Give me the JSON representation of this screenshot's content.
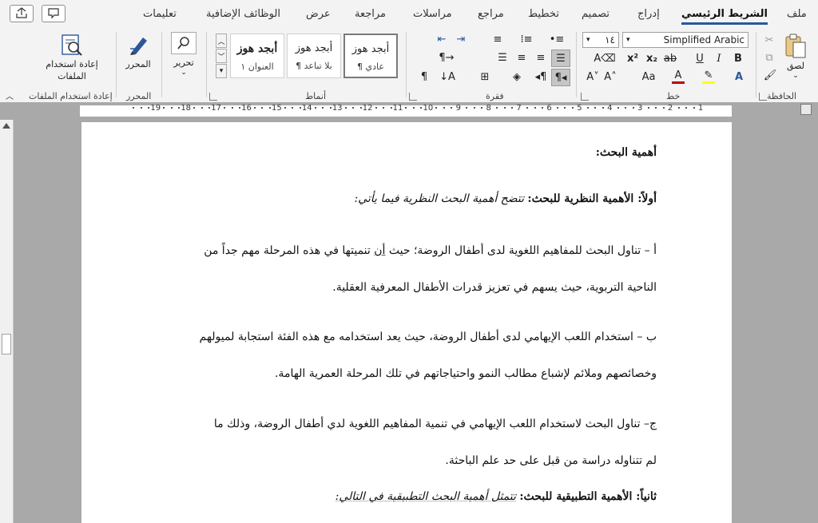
{
  "tabs": [
    "ملف",
    "الشريط الرئيسي",
    "إدراج",
    "تصميم",
    "تخطيط",
    "مراجع",
    "مراسلات",
    "مراجعة",
    "عرض",
    "الوظائف الإضافية",
    "تعليمات"
  ],
  "groups": {
    "clipboard": {
      "label": "الحافظة",
      "paste": "لصق"
    },
    "font": {
      "label": "خط",
      "font_name": "Simplified Arabic",
      "font_size": "١٤"
    },
    "paragraph": {
      "label": "فقرة"
    },
    "styles": {
      "label": "أنماط",
      "items": [
        {
          "preview": "أبجد هوز",
          "name": "¶ عادي"
        },
        {
          "preview": "أبجد هوز",
          "name": "¶ بلا تباعد"
        },
        {
          "preview": "أبجد هوز",
          "name": "العنوان ١"
        }
      ]
    },
    "editing": {
      "edit": "تحرير",
      "editor": "المحرر",
      "editor_group": "المحرر"
    },
    "reuse": {
      "button_line1": "إعادة استخدام",
      "button_line2": "الملفات",
      "label": "إعادة استخدام الملفات"
    }
  },
  "ruler": [
    "1",
    "2",
    "3",
    "4",
    "5",
    "6",
    "7",
    "8",
    "9",
    "10",
    "11",
    "12",
    "13",
    "14",
    "15",
    "16",
    "17",
    "18",
    "19"
  ],
  "document": {
    "heading": "أهمية البحث:",
    "theory_bold": "أولاً: الأهمية النظرية للبحث:",
    "theory_italic": "تتضح أهمية البحث النظرية فيما يأتي:",
    "a_line1_pre": "أ – تناول البحث للمفاهيم اللغوية لدى أطفال الروضة؛ حيث",
    "a_line1_ul": "أن",
    "a_line1_post": "تنميتها في هذه المرحلة مهم جداً من",
    "a_line2": "الناحية التربوية، حيث يسهم في تعزيز قدرات الأطفال المعرفية العقلية.",
    "b_line1": "ب – استخدام اللعب الإيهامي لدى أطفال الروضة، حيث يعد استخدامه مع هذه الفئة استجابة لميولهم",
    "b_line2": "وخصائصهم وملائم لإشباع مطالب النمو واحتياجاتهم في تلك المرحلة العمرية الهامة.",
    "c_line1": "ج– تناول البحث لاستخدام اللعب الإيهامي في تنمية المفاهيم اللغوية لدي أطفال الروضة، وذلك ما",
    "c_line2": "لم تتناوله دراسة من قبل على حد علم الباحثة.",
    "applied_bold": "ثانياً: الأهمية التطبيقية للبحث:",
    "applied_italic": "تتمثل أهمية البحث التطبيقية في التالي:"
  }
}
